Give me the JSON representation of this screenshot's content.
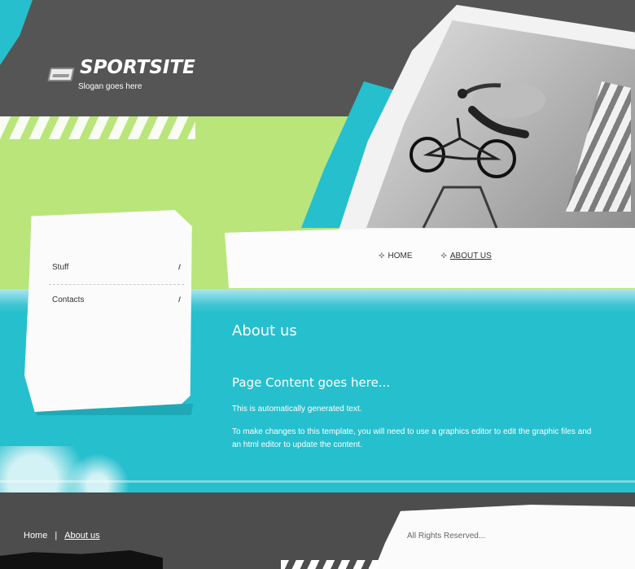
{
  "brand": {
    "title": "SPORTSITE",
    "slogan": "Slogan goes here"
  },
  "sidebar": {
    "items": [
      {
        "label": "Stuff",
        "arrow": "//"
      },
      {
        "label": "Contacts",
        "arrow": "//"
      }
    ]
  },
  "nav": {
    "items": [
      {
        "label": "HOME",
        "active": false
      },
      {
        "label": "ABOUT US",
        "active": true
      }
    ]
  },
  "content": {
    "heading": "About us",
    "subheading": "Page Content goes here...",
    "paragraphs": [
      "This is automatically generated text.",
      "To make changes to this template, you will need to use a graphics editor to edit the graphic files and an html editor to update the content."
    ]
  },
  "footer": {
    "links": [
      {
        "label": "Home",
        "active": false
      },
      {
        "label": "About us",
        "active": true
      }
    ],
    "separator": "|",
    "copyright": "All Rights Reserved..."
  },
  "colors": {
    "teal": "#26bfcd",
    "green": "#b9e57b",
    "dark": "#4c4c4c"
  }
}
